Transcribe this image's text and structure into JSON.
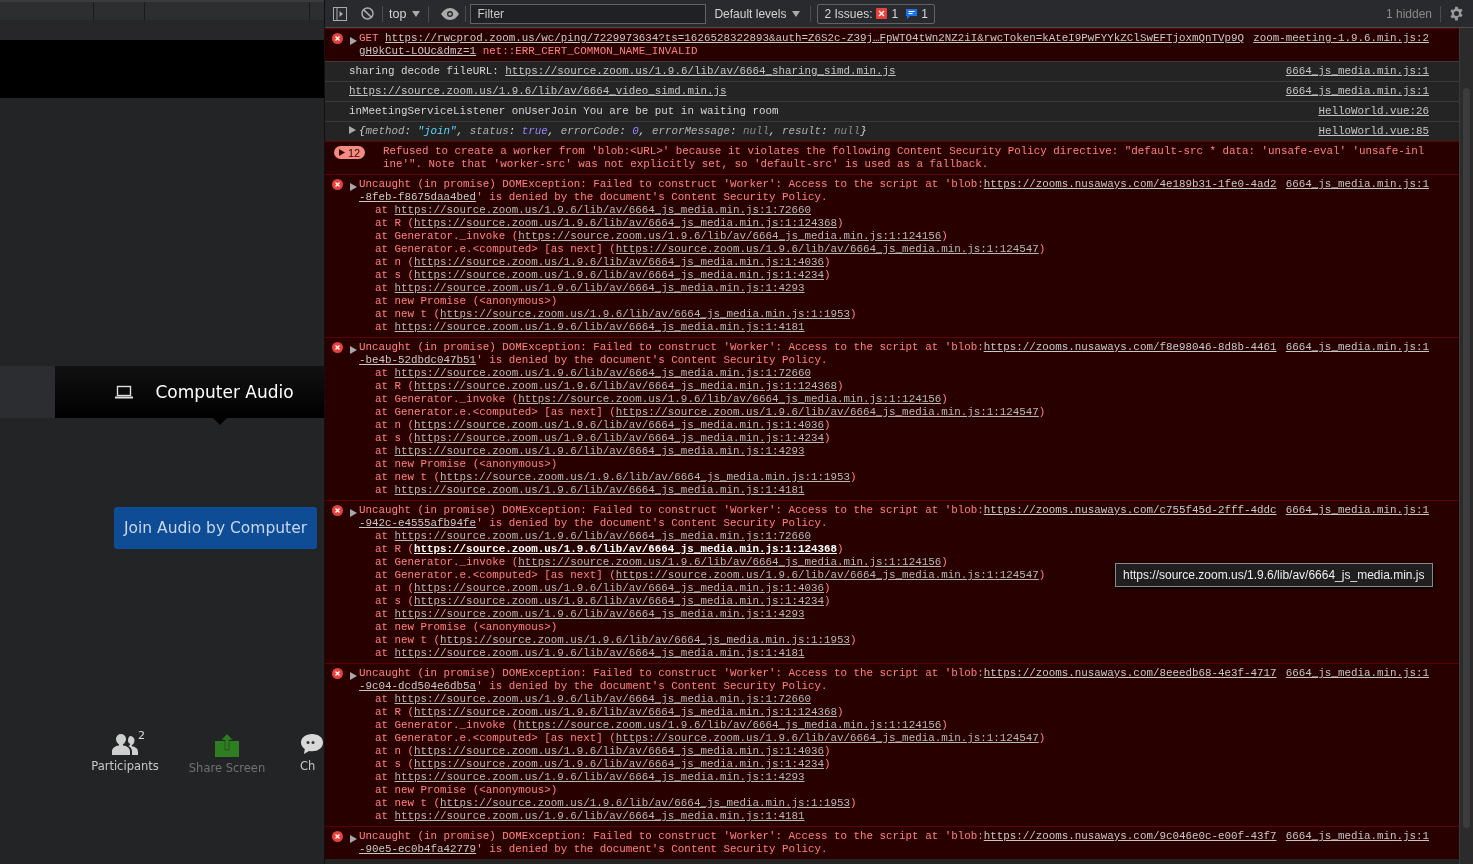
{
  "meeting": {
    "audio_tabs": [
      {
        "label": "Computer Audio",
        "selected": true
      }
    ],
    "join_button": "Join Audio by Computer",
    "toolbar": [
      {
        "kind": "participants",
        "label": "Participants",
        "count": "2"
      },
      {
        "kind": "share",
        "label": "Share Screen"
      },
      {
        "kind": "chat",
        "label": "Ch"
      }
    ]
  },
  "devtools": {
    "context": "top",
    "filter_placeholder": "Filter",
    "levels": "Default levels",
    "issues": {
      "label": "2 Issues:",
      "errors": "1",
      "infos": "1"
    },
    "hidden": "1 hidden",
    "messages": [
      {
        "kind": "request-error",
        "method": "GET",
        "url": "https://rwcprod.zoom.us/wc/ping/7229973634?ts=1626528322893&auth=Z6S2c-Z39j…FpWTO4tWn2NZ2iI&rwcToken=kAteI9PwFYYkZClSwEFTjoxmQnTVp9QgH9kCut-LOUc&dmz=1",
        "detail": "net::ERR_CERT_COMMON_NAME_INVALID",
        "source": "zoom-meeting-1.9.6.min.js:2"
      },
      {
        "kind": "log",
        "text": "sharing decode fileURL:",
        "url": "https://source.zoom.us/1.9.6/lib/av/6664_sharing_simd.min.js",
        "source": "6664_js_media.min.js:1"
      },
      {
        "kind": "log",
        "url": "https://source.zoom.us/1.9.6/lib/av/6664_video_simd.min.js",
        "source": "6664_js_media.min.js:1"
      },
      {
        "kind": "log",
        "text": "inMeetingServiceListener onUserJoin You are be put in waiting room",
        "source": "HelloWorld.vue:26"
      },
      {
        "kind": "object",
        "tokens": [
          {
            "kind": "punct",
            "text": "{"
          },
          {
            "kind": "key",
            "text": "method"
          },
          {
            "kind": "punct",
            "text": ": "
          },
          {
            "kind": "string",
            "text": "\"join\""
          },
          {
            "kind": "punct",
            "text": ", "
          },
          {
            "kind": "key",
            "text": "status"
          },
          {
            "kind": "punct",
            "text": ": "
          },
          {
            "kind": "bool",
            "text": "true"
          },
          {
            "kind": "punct",
            "text": ", "
          },
          {
            "kind": "key",
            "text": "errorCode"
          },
          {
            "kind": "punct",
            "text": ": "
          },
          {
            "kind": "number",
            "text": "0"
          },
          {
            "kind": "punct",
            "text": ", "
          },
          {
            "kind": "key",
            "text": "errorMessage"
          },
          {
            "kind": "punct",
            "text": ": "
          },
          {
            "kind": "null",
            "text": "null"
          },
          {
            "kind": "punct",
            "text": ", "
          },
          {
            "kind": "key",
            "text": "result"
          },
          {
            "kind": "punct",
            "text": ": "
          },
          {
            "kind": "null",
            "text": "null"
          },
          {
            "kind": "punct",
            "text": "}"
          }
        ],
        "source": "HelloWorld.vue:85"
      },
      {
        "kind": "grouped-error",
        "count": "12",
        "text": "Refused to create a worker from 'blob:<URL>' because it violates the following Content Security Policy directive: \"default-src * data: 'unsafe-eval' 'unsafe-inline'\". Note that 'worker-src' was not explicitly set, so 'default-src' is used as a fallback."
      },
      {
        "kind": "exception",
        "before": "Uncaught (in promise) DOMException: Failed to construct 'Worker': Access to the script at 'blob:",
        "url": "https://zooms.nusaways.com/4e189b31-1fe0-4ad2-8feb-f8675daa4bed",
        "after": "' is denied by the document's Content Security Policy.",
        "source": "6664_js_media.min.js:1",
        "stack": [
          {
            "before": "at",
            "url": "https://source.zoom.us/1.9.6/lib/av/6664_js_media.min.js:1:72660"
          },
          {
            "before": "at R (",
            "url": "https://source.zoom.us/1.9.6/lib/av/6664_js_media.min.js:1:124368",
            "after": ")"
          },
          {
            "before": "at Generator._invoke (",
            "url": "https://source.zoom.us/1.9.6/lib/av/6664_js_media.min.js:1:124156",
            "after": ")"
          },
          {
            "before": "at Generator.e.<computed> [as next] (",
            "url": "https://source.zoom.us/1.9.6/lib/av/6664_js_media.min.js:1:124547",
            "after": ")"
          },
          {
            "before": "at n (",
            "url": "https://source.zoom.us/1.9.6/lib/av/6664_js_media.min.js:1:4036",
            "after": ")"
          },
          {
            "before": "at s (",
            "url": "https://source.zoom.us/1.9.6/lib/av/6664_js_media.min.js:1:4234",
            "after": ")"
          },
          {
            "before": "at",
            "url": "https://source.zoom.us/1.9.6/lib/av/6664_js_media.min.js:1:4293"
          },
          {
            "before": "at new Promise (<anonymous>)"
          },
          {
            "before": "at new t (",
            "url": "https://source.zoom.us/1.9.6/lib/av/6664_js_media.min.js:1:1953",
            "after": ")"
          },
          {
            "before": "at",
            "url": "https://source.zoom.us/1.9.6/lib/av/6664_js_media.min.js:1:4181"
          }
        ]
      },
      {
        "kind": "exception",
        "before": "Uncaught (in promise) DOMException: Failed to construct 'Worker': Access to the script at 'blob:",
        "url": "https://zooms.nusaways.com/f8e98046-8d8b-4461-be4b-52dbdc047b51",
        "after": "' is denied by the document's Content Security Policy.",
        "source": "6664_js_media.min.js:1",
        "stack": [
          {
            "before": "at",
            "url": "https://source.zoom.us/1.9.6/lib/av/6664_js_media.min.js:1:72660"
          },
          {
            "before": "at R (",
            "url": "https://source.zoom.us/1.9.6/lib/av/6664_js_media.min.js:1:124368",
            "after": ")"
          },
          {
            "before": "at Generator._invoke (",
            "url": "https://source.zoom.us/1.9.6/lib/av/6664_js_media.min.js:1:124156",
            "after": ")"
          },
          {
            "before": "at Generator.e.<computed> [as next] (",
            "url": "https://source.zoom.us/1.9.6/lib/av/6664_js_media.min.js:1:124547",
            "after": ")"
          },
          {
            "before": "at n (",
            "url": "https://source.zoom.us/1.9.6/lib/av/6664_js_media.min.js:1:4036",
            "after": ")"
          },
          {
            "before": "at s (",
            "url": "https://source.zoom.us/1.9.6/lib/av/6664_js_media.min.js:1:4234",
            "after": ")"
          },
          {
            "before": "at",
            "url": "https://source.zoom.us/1.9.6/lib/av/6664_js_media.min.js:1:4293"
          },
          {
            "before": "at new Promise (<anonymous>)"
          },
          {
            "before": "at new t (",
            "url": "https://source.zoom.us/1.9.6/lib/av/6664_js_media.min.js:1:1953",
            "after": ")"
          },
          {
            "before": "at",
            "url": "https://source.zoom.us/1.9.6/lib/av/6664_js_media.min.js:1:4181"
          }
        ]
      },
      {
        "kind": "exception",
        "before": "Uncaught (in promise) DOMException: Failed to construct 'Worker': Access to the script at 'blob:",
        "url": "https://zooms.nusaways.com/c755f45d-2fff-4ddc-942c-e4555afb94fe",
        "after": "' is denied by the document's Content Security Policy.",
        "source": "6664_js_media.min.js:1",
        "stack": [
          {
            "before": "at",
            "url": "https://source.zoom.us/1.9.6/lib/av/6664_js_media.min.js:1:72660"
          },
          {
            "before": "at R (",
            "url": "https://source.zoom.us/1.9.6/lib/av/6664_js_media.min.js:1:124368",
            "after": ")",
            "hovered": true
          },
          {
            "before": "at Generator._invoke (",
            "url": "https://source.zoom.us/1.9.6/lib/av/6664_js_media.min.js:1:124156",
            "after": ")"
          },
          {
            "before": "at Generator.e.<computed> [as next] (",
            "url": "https://source.zoom.us/1.9.6/lib/av/6664_js_media.min.js:1:124547",
            "after": ")"
          },
          {
            "before": "at n (",
            "url": "https://source.zoom.us/1.9.6/lib/av/6664_js_media.min.js:1:4036",
            "after": ")"
          },
          {
            "before": "at s (",
            "url": "https://source.zoom.us/1.9.6/lib/av/6664_js_media.min.js:1:4234",
            "after": ")"
          },
          {
            "before": "at",
            "url": "https://source.zoom.us/1.9.6/lib/av/6664_js_media.min.js:1:4293"
          },
          {
            "before": "at new Promise (<anonymous>)"
          },
          {
            "before": "at new t (",
            "url": "https://source.zoom.us/1.9.6/lib/av/6664_js_media.min.js:1:1953",
            "after": ")"
          },
          {
            "before": "at",
            "url": "https://source.zoom.us/1.9.6/lib/av/6664_js_media.min.js:1:4181"
          }
        ]
      },
      {
        "kind": "exception",
        "before": "Uncaught (in promise) DOMException: Failed to construct 'Worker': Access to the script at 'blob:",
        "url": "https://zooms.nusaways.com/8eeedb68-4e3f-4717-9c04-dcd504e6db5a",
        "after": "' is denied by the document's Content Security Policy.",
        "source": "6664_js_media.min.js:1",
        "stack": [
          {
            "before": "at",
            "url": "https://source.zoom.us/1.9.6/lib/av/6664_js_media.min.js:1:72660"
          },
          {
            "before": "at R (",
            "url": "https://source.zoom.us/1.9.6/lib/av/6664_js_media.min.js:1:124368",
            "after": ")"
          },
          {
            "before": "at Generator._invoke (",
            "url": "https://source.zoom.us/1.9.6/lib/av/6664_js_media.min.js:1:124156",
            "after": ")"
          },
          {
            "before": "at Generator.e.<computed> [as next] (",
            "url": "https://source.zoom.us/1.9.6/lib/av/6664_js_media.min.js:1:124547",
            "after": ")"
          },
          {
            "before": "at n (",
            "url": "https://source.zoom.us/1.9.6/lib/av/6664_js_media.min.js:1:4036",
            "after": ")"
          },
          {
            "before": "at s (",
            "url": "https://source.zoom.us/1.9.6/lib/av/6664_js_media.min.js:1:4234",
            "after": ")"
          },
          {
            "before": "at",
            "url": "https://source.zoom.us/1.9.6/lib/av/6664_js_media.min.js:1:4293"
          },
          {
            "before": "at new Promise (<anonymous>)"
          },
          {
            "before": "at new t (",
            "url": "https://source.zoom.us/1.9.6/lib/av/6664_js_media.min.js:1:1953",
            "after": ")"
          },
          {
            "before": "at",
            "url": "https://source.zoom.us/1.9.6/lib/av/6664_js_media.min.js:1:4181"
          }
        ]
      },
      {
        "kind": "exception",
        "before": "Uncaught (in promise) DOMException: Failed to construct 'Worker': Access to the script at 'blob:",
        "url": "https://zooms.nusaways.com/9c046e0c-e00f-43f7-90e5-ec0b4fa42779",
        "after": "' is denied by the document's Content Security Policy.",
        "source": "6664_js_media.min.js:1"
      }
    ],
    "tooltip": "https://source.zoom.us/1.9.6/lib/av/6664_js_media.min.js"
  }
}
